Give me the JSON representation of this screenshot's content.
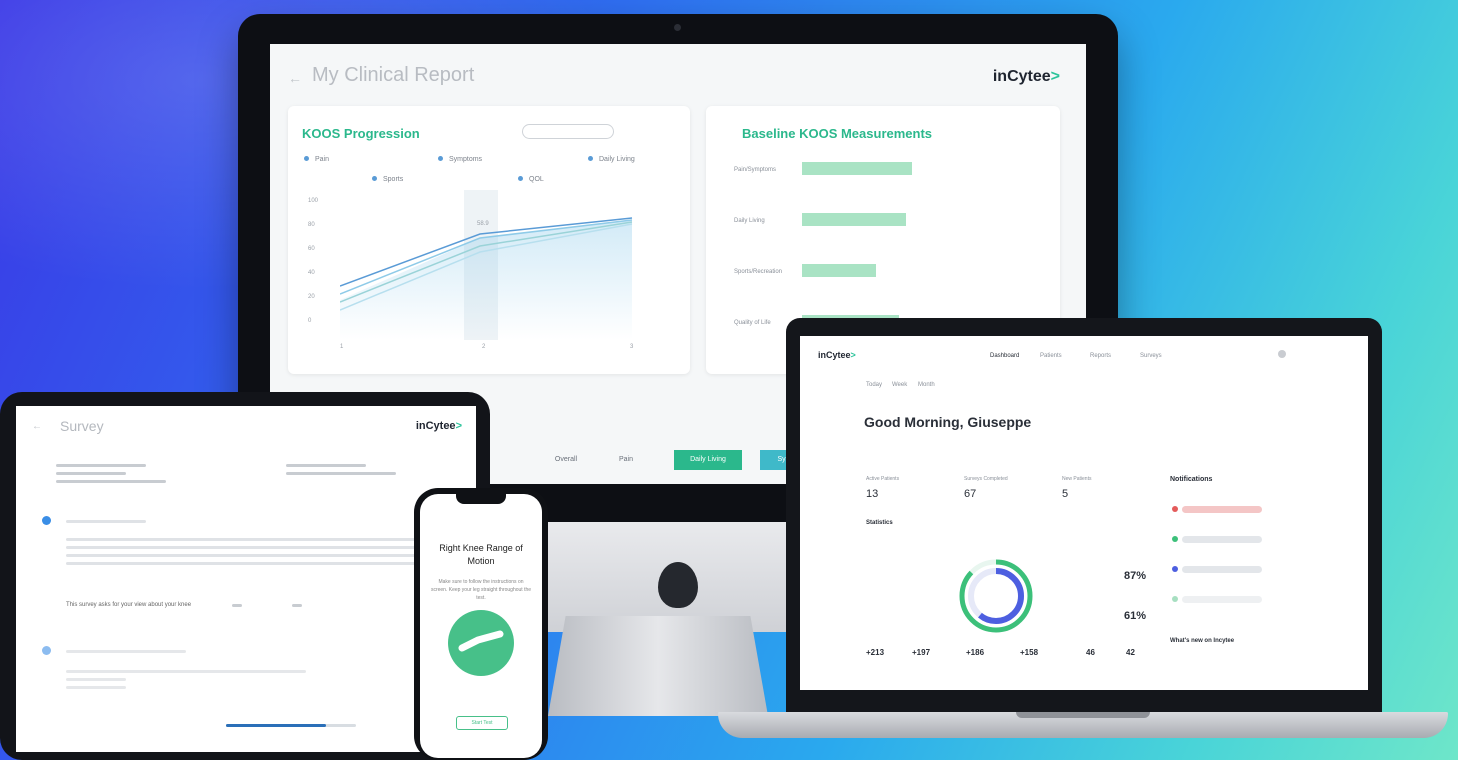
{
  "imac": {
    "title": "My Clinical Report",
    "logo": "inCytee",
    "kdos_card": {
      "title": "KOOS Progression",
      "legend": [
        "Pain",
        "Symptoms",
        "Daily Living",
        "Sports",
        "QOL"
      ],
      "x_ticks": [
        "1",
        "2",
        "3"
      ],
      "y_ticks": [
        "100",
        "80",
        "60",
        "40",
        "20",
        "0"
      ],
      "callout": "58.9"
    },
    "baseline_card": {
      "title": "Baseline KOOS Measurements",
      "bars": [
        {
          "label": "Pain/Symptoms",
          "value": 0.48
        },
        {
          "label": "Daily Living",
          "value": 0.45
        },
        {
          "label": "Sports/Recreation",
          "value": 0.32
        },
        {
          "label": "Quality of Life",
          "value": 0.42
        }
      ]
    },
    "table_tabs": [
      "Overall",
      "Pain",
      "Daily Living",
      "Symptoms"
    ],
    "colors": {
      "accent": "#2bb88c",
      "teal": "#3fb9c9",
      "line": "#5a9bd6"
    }
  },
  "tablet": {
    "title": "Survey",
    "logo": "inCytee",
    "question": "This survey asks for your view about your knee"
  },
  "phone": {
    "title": "Right Knee Range of Motion",
    "instructions": "Make sure to follow the instructions on screen. Keep your leg straight throughout the test.",
    "button": "Start Test"
  },
  "laptop": {
    "logo": "inCytee",
    "nav": [
      "Dashboard",
      "Patients",
      "Reports",
      "Surveys"
    ],
    "tabs": [
      "Today",
      "Week",
      "Month"
    ],
    "greeting": "Good Morning, Giuseppe",
    "stats": [
      {
        "label": "Active Patients",
        "value": "13"
      },
      {
        "label": "Surveys Completed",
        "value": "67"
      },
      {
        "label": "New Patients",
        "value": "5"
      }
    ],
    "section_title": "Statistics",
    "percent_a": "87%",
    "percent_b": "61%",
    "progress_a": 0.87,
    "progress_b": 0.61,
    "mini_stats": [
      "+213",
      "+197",
      "+186",
      "+158",
      "46",
      "42"
    ],
    "notifications_title": "Notifications",
    "events_title": "What's new on Incytee"
  }
}
